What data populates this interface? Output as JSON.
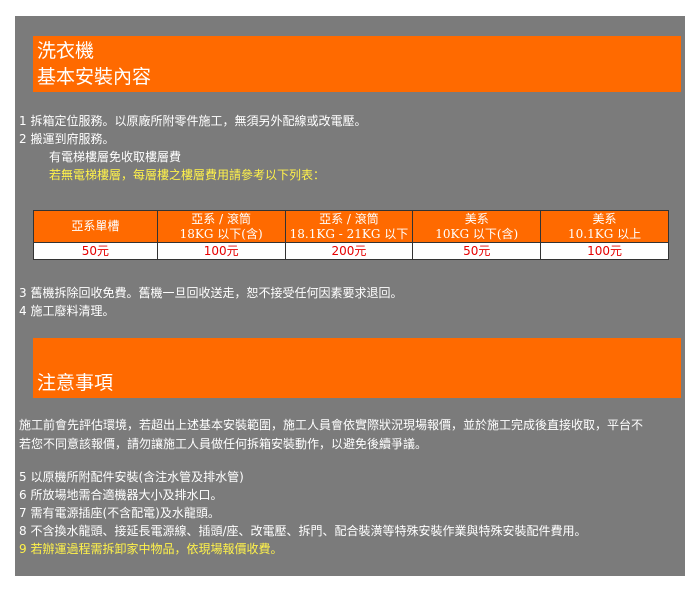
{
  "header1": {
    "line1": "洗衣機",
    "line2": "基本安裝內容"
  },
  "list1": [
    "1  拆箱定位服務。以原廠所附零件施工，無須另外配線或改電壓。",
    "2  搬運到府服務。"
  ],
  "sub_lines": [
    "有電梯樓層免收取樓層費",
    "若無電梯樓層，每層樓之樓層費用請參考以下列表："
  ],
  "price_table": {
    "headers": [
      {
        "top": "亞系單槽",
        "bottom": ""
      },
      {
        "top": "亞系 / 滾筒",
        "bottom": "18KG 以下(含)"
      },
      {
        "top": "亞系 / 滾筒",
        "bottom": "18.1KG - 21KG 以下"
      },
      {
        "top": "美系",
        "bottom": "10KG 以下(含)"
      },
      {
        "top": "美系",
        "bottom": "10.1KG 以上"
      }
    ],
    "prices": [
      "50元",
      "100元",
      "200元",
      "50元",
      "100元"
    ]
  },
  "list2": [
    "3  舊機拆除回收免費。舊機一旦回收送走，恕不接受任何因素要求退回。",
    "4  施工廢料清理。"
  ],
  "header2": {
    "title": "注意事項"
  },
  "note": {
    "line1": "施工前會先評估環境，若超出上述基本安裝範圍，施工人員會依實際狀況現場報價，並於施工完成後直接收取，平台不",
    "line2": "若您不同意該報價，請勿讓施工人員做任何拆箱安裝動作，以避免後續爭議。"
  },
  "list3": [
    "5  以原機所附配件安裝(含注水管及排水管)",
    "6  所放場地需合適機器大小及排水口。",
    "7  需有電源插座(不含配電)及水龍頭。",
    "8  不含換水龍頭、接延長電源線、插頭/座、改電壓、拆門、配合裝潢等特殊安裝作業與特殊安裝配件費用。",
    "9  若辦運過程需拆卸家中物品，依現場報價收費。"
  ],
  "colors": {
    "panel_bg": "#7b7b7b",
    "accent_orange": "#ff6a00",
    "highlight_yellow": "#fff24a",
    "price_red": "#e60000"
  }
}
